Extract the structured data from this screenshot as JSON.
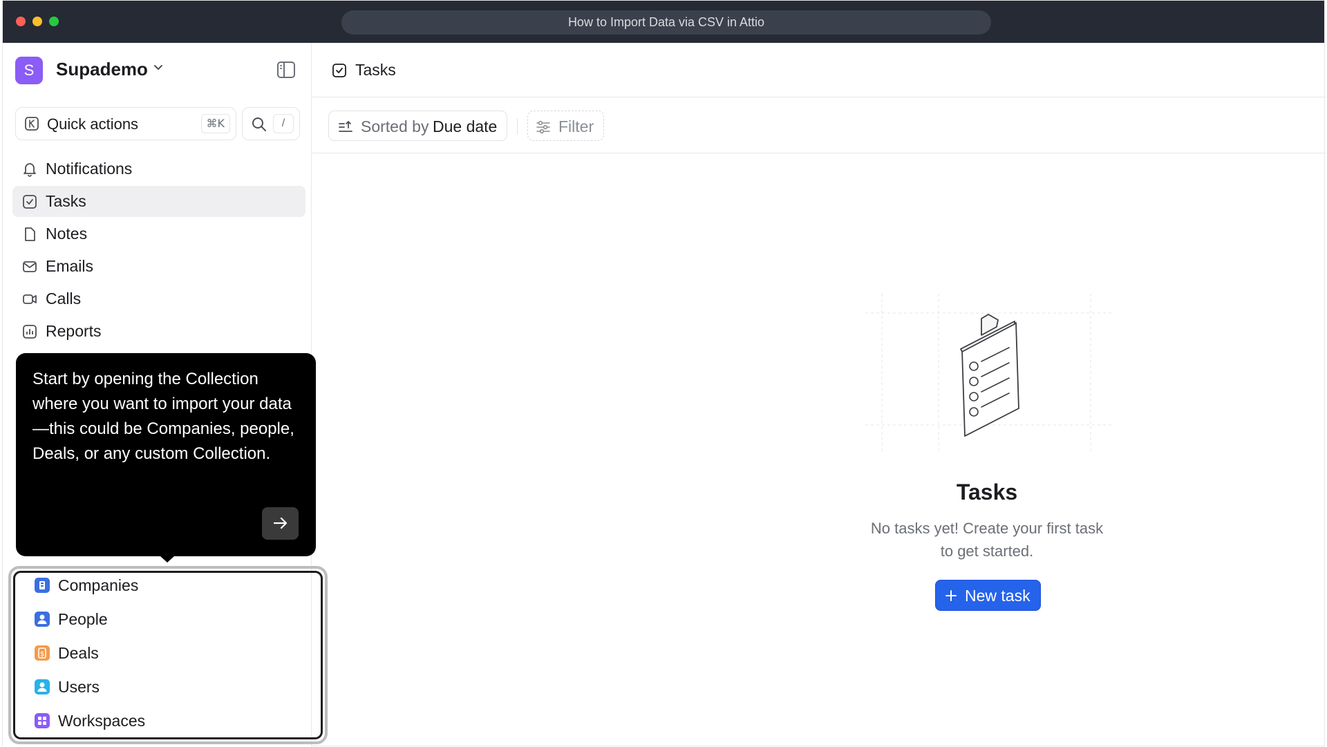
{
  "browser": {
    "url_title": "How to Import Data via CSV in Attio"
  },
  "workspace": {
    "initial": "S",
    "name": "Supademo",
    "avatar_color": "#8b5cf6"
  },
  "quick_actions": {
    "label": "Quick actions",
    "shortcut": "⌘K",
    "search_shortcut": "/"
  },
  "nav": {
    "items": [
      {
        "label": "Notifications",
        "icon": "bell-icon"
      },
      {
        "label": "Tasks",
        "icon": "checkbox-icon",
        "active": true
      },
      {
        "label": "Notes",
        "icon": "note-icon"
      },
      {
        "label": "Emails",
        "icon": "mail-icon"
      },
      {
        "label": "Calls",
        "icon": "video-icon"
      },
      {
        "label": "Reports",
        "icon": "chart-icon"
      }
    ]
  },
  "tooltip": {
    "text": "Start by opening the Collection where you want to import your data—this could be Companies, people, Deals, or any custom Collection."
  },
  "collections": {
    "items": [
      {
        "label": "Companies",
        "color": "#3b6fe0"
      },
      {
        "label": "People",
        "color": "#3b6fe0"
      },
      {
        "label": "Deals",
        "color": "#f59a4a"
      },
      {
        "label": "Users",
        "color": "#2bb0e8"
      },
      {
        "label": "Workspaces",
        "color": "#8b5cf6"
      }
    ]
  },
  "main": {
    "title": "Tasks",
    "sort_prefix": "Sorted by",
    "sort_value": "Due date",
    "filter_label": "Filter",
    "empty_title": "Tasks",
    "empty_desc": "No tasks yet! Create your first task to get started.",
    "new_task_label": "New task",
    "accent_color": "#2563eb"
  }
}
